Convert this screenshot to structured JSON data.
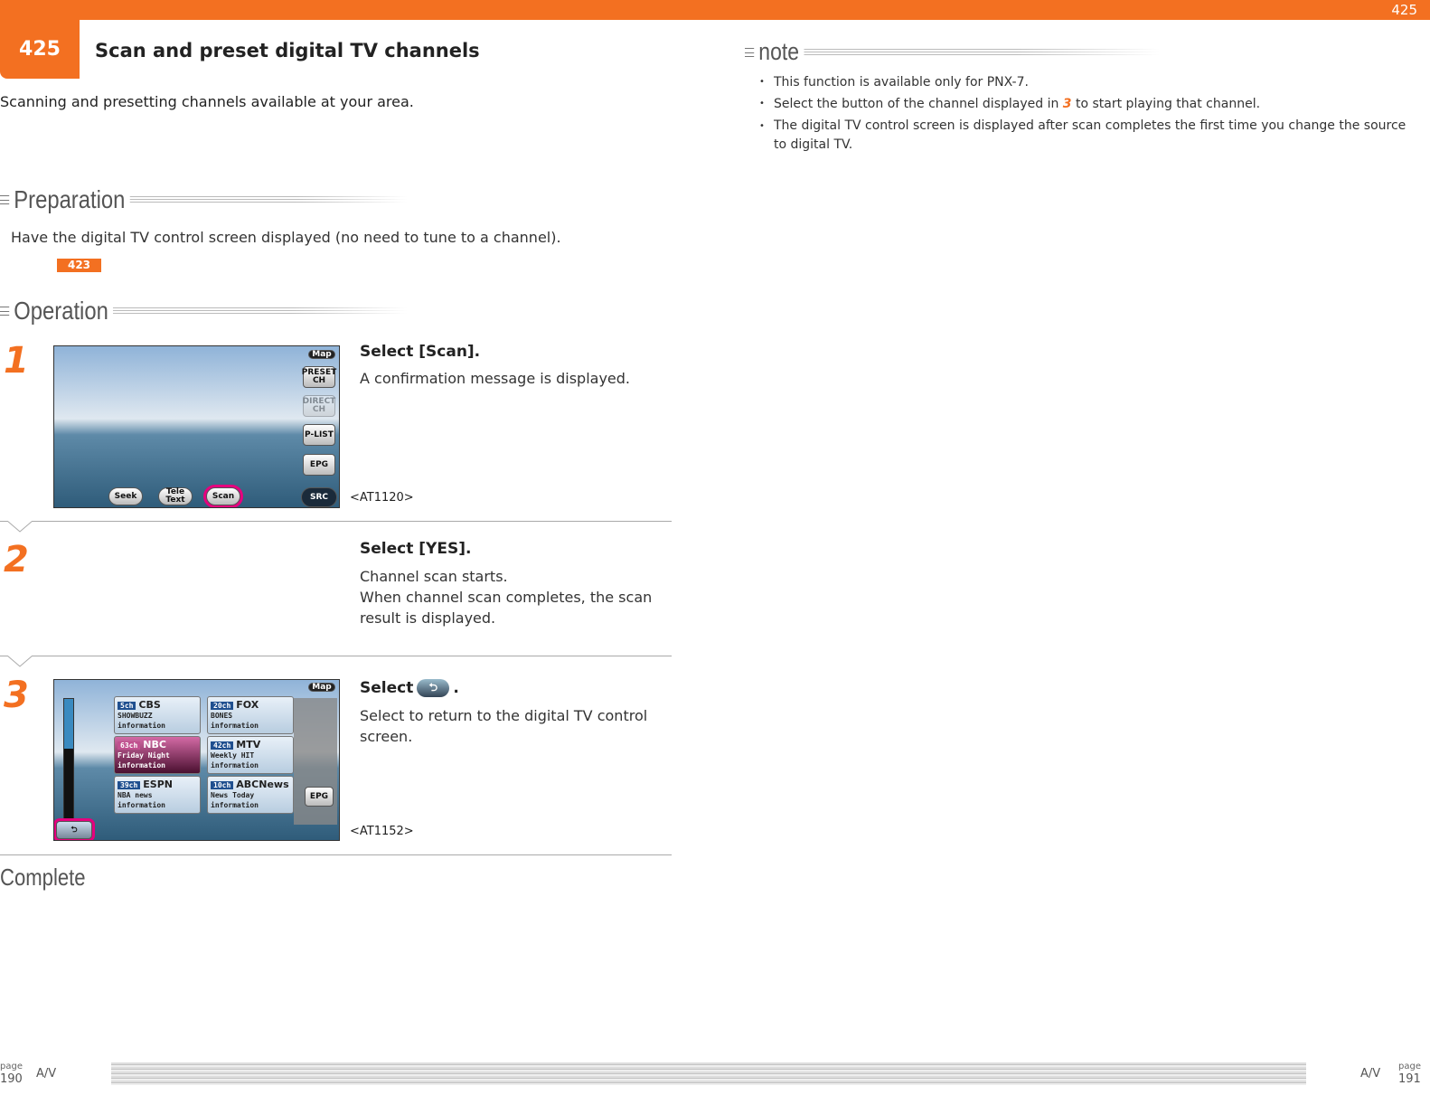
{
  "header": {
    "section_number": "425",
    "title": "Scan and preset digital TV channels",
    "subtitle": "Scanning and presetting channels available at your area.",
    "accent": "#f37021"
  },
  "preparation": {
    "heading": "Preparation",
    "text": "Have the digital TV control screen displayed (no need to tune to a channel).",
    "ref": "423"
  },
  "operation": {
    "heading": "Operation"
  },
  "steps": [
    {
      "num": "1",
      "title": "Select [Scan].",
      "lines": [
        "A confirmation message is displayed."
      ],
      "caption": "<AT1120>",
      "screen": {
        "map": "Map",
        "preset": "PRESET CH",
        "direct": "DIRECT CH",
        "plist": "P-LIST",
        "epg": "EPG",
        "src": "SRC",
        "seek": "Seek",
        "tele": "Tele Text",
        "scan": "Scan"
      }
    },
    {
      "num": "2",
      "title": "Select [YES].",
      "lines": [
        "Channel scan starts.",
        "When channel scan completes, the scan result is displayed."
      ]
    },
    {
      "num": "3",
      "title_prefix": "Select",
      "title_suffix": ".",
      "lines": [
        "Select to return to the digital TV control screen."
      ],
      "caption": "<AT1152>",
      "screen": {
        "map": "Map",
        "epg": "EPG",
        "channels": [
          {
            "num": "5ch",
            "name": "CBS",
            "prog": "SHOWBUZZ",
            "info": "information"
          },
          {
            "num": "20ch",
            "name": "FOX",
            "prog": "BONES",
            "info": "information"
          },
          {
            "num": "63ch",
            "name": "NBC",
            "prog": "Friday Night",
            "info": "information",
            "selected": true
          },
          {
            "num": "42ch",
            "name": "MTV",
            "prog": "Weekly HIT",
            "info": "information"
          },
          {
            "num": "39ch",
            "name": "ESPN",
            "prog": "NBA news",
            "info": "information"
          },
          {
            "num": "10ch",
            "name": "ABCNews",
            "prog": "News Today",
            "info": "information"
          }
        ]
      }
    }
  ],
  "complete": "Complete",
  "note": {
    "heading": "note",
    "items": [
      "This function is available only for PNX-7.",
      "Select the button of the channel displayed in",
      "The digital TV control screen is displayed after scan completes the first time you change the source to digital TV."
    ],
    "item2_ref": "3",
    "item2_rest": " to start playing that channel."
  },
  "footer": {
    "left_label": "page",
    "left_page": "190",
    "left_section": "A/V",
    "right_section": "A/V",
    "right_label": "page",
    "right_page": "191"
  }
}
